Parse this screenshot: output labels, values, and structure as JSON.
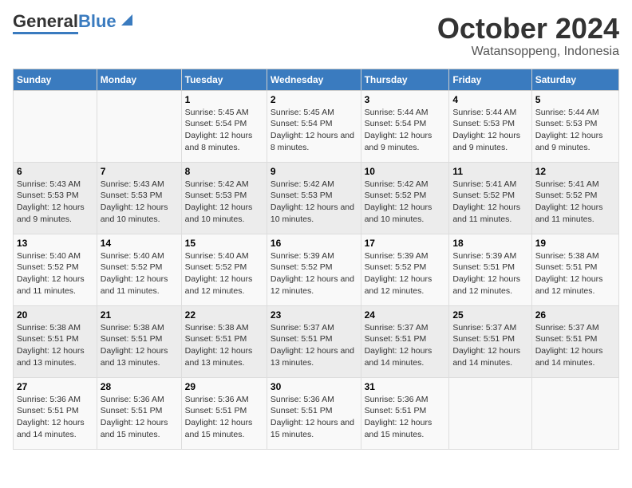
{
  "logo": {
    "text_general": "General",
    "text_blue": "Blue"
  },
  "title": {
    "month": "October 2024",
    "location": "Watansoppeng, Indonesia"
  },
  "days_of_week": [
    "Sunday",
    "Monday",
    "Tuesday",
    "Wednesday",
    "Thursday",
    "Friday",
    "Saturday"
  ],
  "weeks": [
    [
      {
        "day": "",
        "sunrise": "",
        "sunset": "",
        "daylight": ""
      },
      {
        "day": "",
        "sunrise": "",
        "sunset": "",
        "daylight": ""
      },
      {
        "day": "1",
        "sunrise": "Sunrise: 5:45 AM",
        "sunset": "Sunset: 5:54 PM",
        "daylight": "Daylight: 12 hours and 8 minutes."
      },
      {
        "day": "2",
        "sunrise": "Sunrise: 5:45 AM",
        "sunset": "Sunset: 5:54 PM",
        "daylight": "Daylight: 12 hours and 8 minutes."
      },
      {
        "day": "3",
        "sunrise": "Sunrise: 5:44 AM",
        "sunset": "Sunset: 5:54 PM",
        "daylight": "Daylight: 12 hours and 9 minutes."
      },
      {
        "day": "4",
        "sunrise": "Sunrise: 5:44 AM",
        "sunset": "Sunset: 5:53 PM",
        "daylight": "Daylight: 12 hours and 9 minutes."
      },
      {
        "day": "5",
        "sunrise": "Sunrise: 5:44 AM",
        "sunset": "Sunset: 5:53 PM",
        "daylight": "Daylight: 12 hours and 9 minutes."
      }
    ],
    [
      {
        "day": "6",
        "sunrise": "Sunrise: 5:43 AM",
        "sunset": "Sunset: 5:53 PM",
        "daylight": "Daylight: 12 hours and 9 minutes."
      },
      {
        "day": "7",
        "sunrise": "Sunrise: 5:43 AM",
        "sunset": "Sunset: 5:53 PM",
        "daylight": "Daylight: 12 hours and 10 minutes."
      },
      {
        "day": "8",
        "sunrise": "Sunrise: 5:42 AM",
        "sunset": "Sunset: 5:53 PM",
        "daylight": "Daylight: 12 hours and 10 minutes."
      },
      {
        "day": "9",
        "sunrise": "Sunrise: 5:42 AM",
        "sunset": "Sunset: 5:53 PM",
        "daylight": "Daylight: 12 hours and 10 minutes."
      },
      {
        "day": "10",
        "sunrise": "Sunrise: 5:42 AM",
        "sunset": "Sunset: 5:52 PM",
        "daylight": "Daylight: 12 hours and 10 minutes."
      },
      {
        "day": "11",
        "sunrise": "Sunrise: 5:41 AM",
        "sunset": "Sunset: 5:52 PM",
        "daylight": "Daylight: 12 hours and 11 minutes."
      },
      {
        "day": "12",
        "sunrise": "Sunrise: 5:41 AM",
        "sunset": "Sunset: 5:52 PM",
        "daylight": "Daylight: 12 hours and 11 minutes."
      }
    ],
    [
      {
        "day": "13",
        "sunrise": "Sunrise: 5:40 AM",
        "sunset": "Sunset: 5:52 PM",
        "daylight": "Daylight: 12 hours and 11 minutes."
      },
      {
        "day": "14",
        "sunrise": "Sunrise: 5:40 AM",
        "sunset": "Sunset: 5:52 PM",
        "daylight": "Daylight: 12 hours and 11 minutes."
      },
      {
        "day": "15",
        "sunrise": "Sunrise: 5:40 AM",
        "sunset": "Sunset: 5:52 PM",
        "daylight": "Daylight: 12 hours and 12 minutes."
      },
      {
        "day": "16",
        "sunrise": "Sunrise: 5:39 AM",
        "sunset": "Sunset: 5:52 PM",
        "daylight": "Daylight: 12 hours and 12 minutes."
      },
      {
        "day": "17",
        "sunrise": "Sunrise: 5:39 AM",
        "sunset": "Sunset: 5:52 PM",
        "daylight": "Daylight: 12 hours and 12 minutes."
      },
      {
        "day": "18",
        "sunrise": "Sunrise: 5:39 AM",
        "sunset": "Sunset: 5:51 PM",
        "daylight": "Daylight: 12 hours and 12 minutes."
      },
      {
        "day": "19",
        "sunrise": "Sunrise: 5:38 AM",
        "sunset": "Sunset: 5:51 PM",
        "daylight": "Daylight: 12 hours and 12 minutes."
      }
    ],
    [
      {
        "day": "20",
        "sunrise": "Sunrise: 5:38 AM",
        "sunset": "Sunset: 5:51 PM",
        "daylight": "Daylight: 12 hours and 13 minutes."
      },
      {
        "day": "21",
        "sunrise": "Sunrise: 5:38 AM",
        "sunset": "Sunset: 5:51 PM",
        "daylight": "Daylight: 12 hours and 13 minutes."
      },
      {
        "day": "22",
        "sunrise": "Sunrise: 5:38 AM",
        "sunset": "Sunset: 5:51 PM",
        "daylight": "Daylight: 12 hours and 13 minutes."
      },
      {
        "day": "23",
        "sunrise": "Sunrise: 5:37 AM",
        "sunset": "Sunset: 5:51 PM",
        "daylight": "Daylight: 12 hours and 13 minutes."
      },
      {
        "day": "24",
        "sunrise": "Sunrise: 5:37 AM",
        "sunset": "Sunset: 5:51 PM",
        "daylight": "Daylight: 12 hours and 14 minutes."
      },
      {
        "day": "25",
        "sunrise": "Sunrise: 5:37 AM",
        "sunset": "Sunset: 5:51 PM",
        "daylight": "Daylight: 12 hours and 14 minutes."
      },
      {
        "day": "26",
        "sunrise": "Sunrise: 5:37 AM",
        "sunset": "Sunset: 5:51 PM",
        "daylight": "Daylight: 12 hours and 14 minutes."
      }
    ],
    [
      {
        "day": "27",
        "sunrise": "Sunrise: 5:36 AM",
        "sunset": "Sunset: 5:51 PM",
        "daylight": "Daylight: 12 hours and 14 minutes."
      },
      {
        "day": "28",
        "sunrise": "Sunrise: 5:36 AM",
        "sunset": "Sunset: 5:51 PM",
        "daylight": "Daylight: 12 hours and 15 minutes."
      },
      {
        "day": "29",
        "sunrise": "Sunrise: 5:36 AM",
        "sunset": "Sunset: 5:51 PM",
        "daylight": "Daylight: 12 hours and 15 minutes."
      },
      {
        "day": "30",
        "sunrise": "Sunrise: 5:36 AM",
        "sunset": "Sunset: 5:51 PM",
        "daylight": "Daylight: 12 hours and 15 minutes."
      },
      {
        "day": "31",
        "sunrise": "Sunrise: 5:36 AM",
        "sunset": "Sunset: 5:51 PM",
        "daylight": "Daylight: 12 hours and 15 minutes."
      },
      {
        "day": "",
        "sunrise": "",
        "sunset": "",
        "daylight": ""
      },
      {
        "day": "",
        "sunrise": "",
        "sunset": "",
        "daylight": ""
      }
    ]
  ]
}
